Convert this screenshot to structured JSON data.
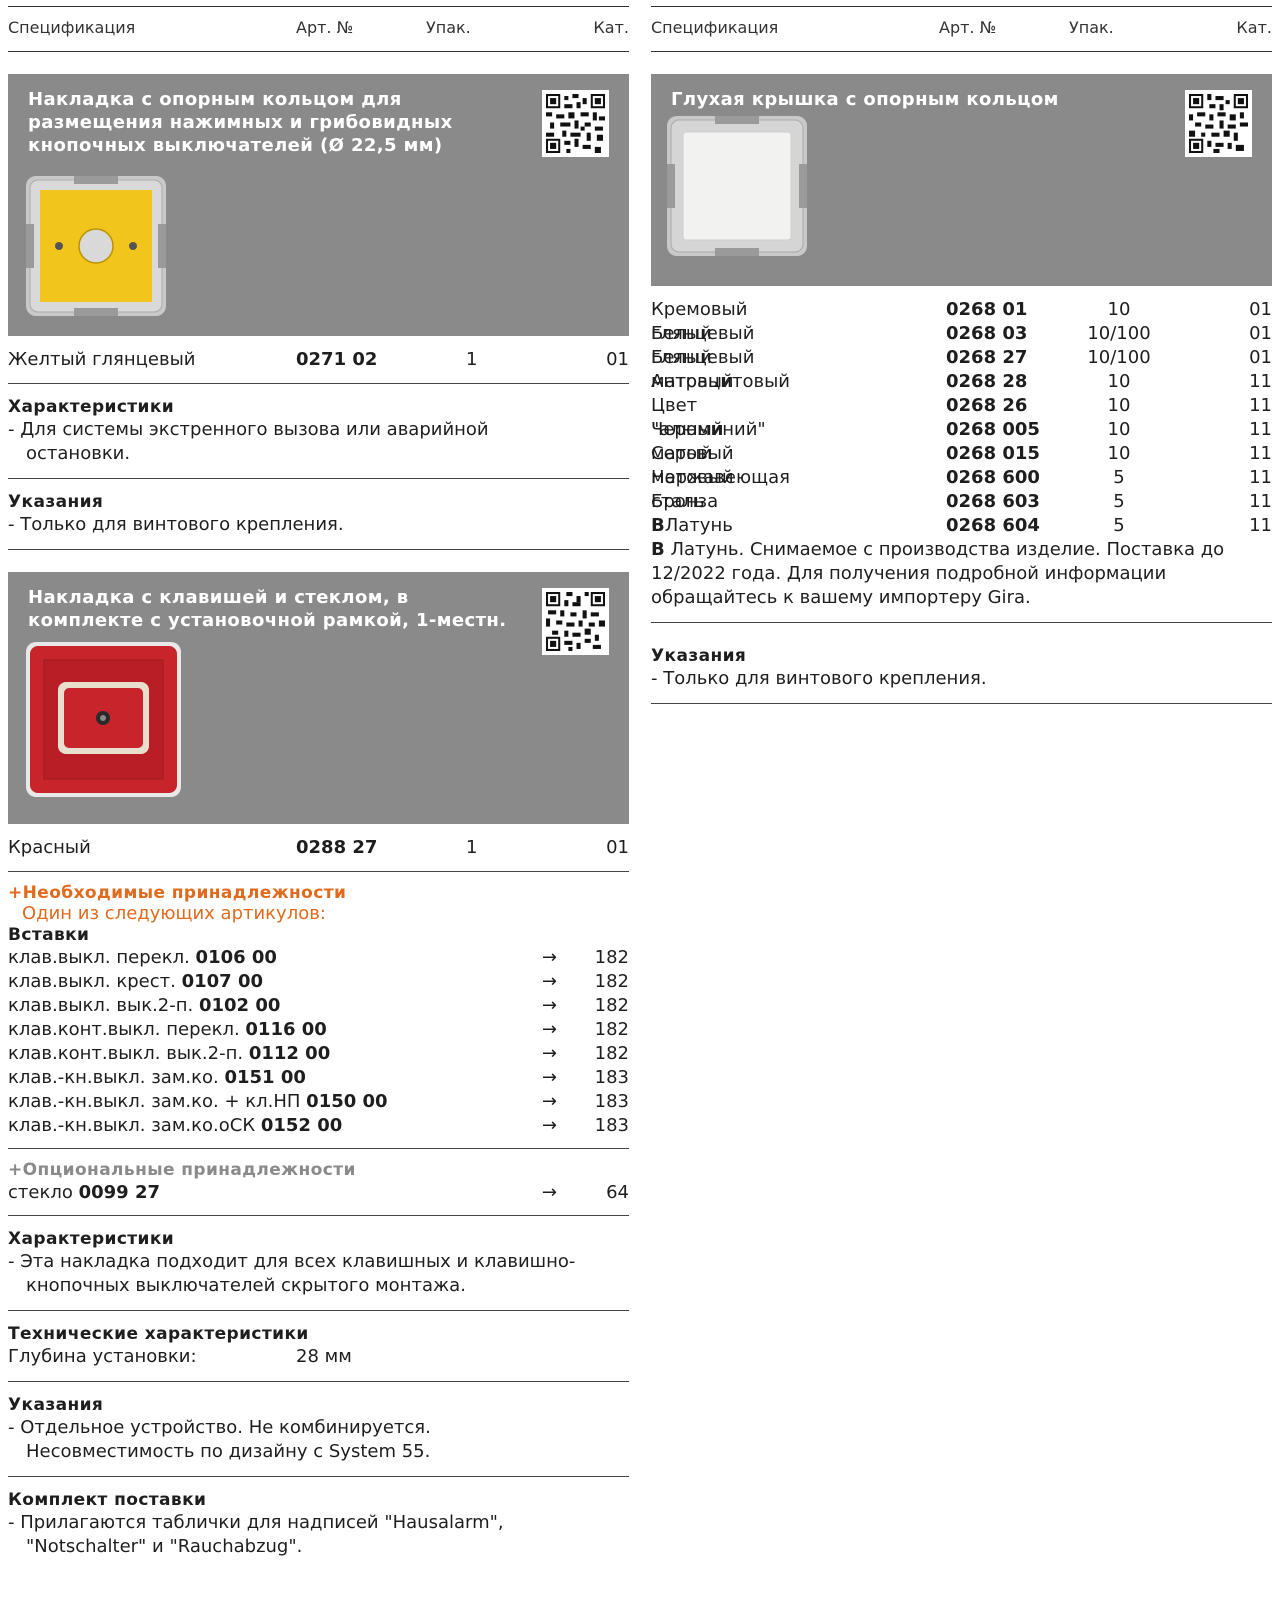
{
  "header": {
    "spec": "Спецификация",
    "art": "Арт. №",
    "pack": "Упак.",
    "cat": "Кат."
  },
  "left": {
    "product1": {
      "title_lines": [
        "Накладка с опорным кольцом для",
        "размещения нажимных и грибовидных",
        "кнопочных выключателей (Ø 22,5 мм)"
      ],
      "row": {
        "name": "Желтый глянцевый",
        "art": "0271 02",
        "pack": "1",
        "cat": "01"
      },
      "features_title": "Характеристики",
      "features": [
        "- Для системы экстренного вызова или аварийной остановки."
      ],
      "notes_title": "Указания",
      "notes": [
        "- Только для винтового крепления."
      ]
    },
    "product2": {
      "title_lines": [
        "Накладка с клавишей и стеклом, в",
        "комплекте с установочной рамкой, 1-местн."
      ],
      "row": {
        "name": "Красный",
        "art": "0288 27",
        "pack": "1",
        "cat": "01"
      },
      "required_title": "Необходимые принадлежности",
      "required_sub": "Один из следующих артикулов:",
      "inserts_title": "Вставки",
      "inserts": [
        {
          "text": "клав.выкл. перекл. ",
          "art": "0106 00",
          "page": "182"
        },
        {
          "text": "клав.выкл. крест. ",
          "art": "0107 00",
          "page": "182"
        },
        {
          "text": "клав.выкл. вык.2-п. ",
          "art": "0102 00",
          "page": "182"
        },
        {
          "text": "клав.конт.выкл. перекл. ",
          "art": "0116 00",
          "page": "182"
        },
        {
          "text": "клав.конт.выкл. вык.2-п. ",
          "art": "0112 00",
          "page": "182"
        },
        {
          "text": "клав.-кн.выкл. зам.ко. ",
          "art": "0151 00",
          "page": "183"
        },
        {
          "text": "клав.-кн.выкл. зам.ко. + кл.НП ",
          "art": "0150 00",
          "page": "183"
        },
        {
          "text": "клав.-кн.выкл. зам.ко.оСК ",
          "art": "0152 00",
          "page": "183"
        }
      ],
      "arrow": "→",
      "optional_title": "Опциональные принадлежности",
      "optional": [
        {
          "text": "стекло ",
          "art": "0099 27",
          "page": "64"
        }
      ],
      "features_title": "Характеристики",
      "features": [
        "- Эта накладка подходит для всех клавишных и клавишно-кнопочных выключателей скрытого монтажа."
      ],
      "tech_title": "Технические характеристики",
      "tech_label": "Глубина установки:",
      "tech_value": "28 мм",
      "notes_title": "Указания",
      "notes": [
        "- Отдельное устройство. Не комбинируется. Несовместимость по дизайну с System 55."
      ],
      "kit_title": "Комплект поставки",
      "kit": [
        "- Прилагаются таблички для надписей \"Hausalarm\", \"Notschalter\" и \"Rauchabzug\"."
      ]
    },
    "plus": "+"
  },
  "right": {
    "product": {
      "title": "Глухая крышка с опорным кольцом",
      "rows": [
        {
          "pre": "",
          "name": "Кремовый глянцевый",
          "art": "0268 01",
          "pack": "10",
          "cat": "01"
        },
        {
          "pre": "",
          "name": "Белый глянцевый",
          "art": "0268 03",
          "pack": "10/100",
          "cat": "01"
        },
        {
          "pre": "",
          "name": "Белый матовый",
          "art": "0268 27",
          "pack": "10/100",
          "cat": "01"
        },
        {
          "pre": "",
          "name": "Антрацитовый",
          "art": "0268 28",
          "pack": "10",
          "cat": "11"
        },
        {
          "pre": "",
          "name": "Цвет \"алюминий\"",
          "art": "0268 26",
          "pack": "10",
          "cat": "11"
        },
        {
          "pre": "",
          "name": "Черный матовый",
          "art": "0268 005",
          "pack": "10",
          "cat": "11"
        },
        {
          "pre": "",
          "name": "Серый матовый",
          "art": "0268 015",
          "pack": "10",
          "cat": "11"
        },
        {
          "pre": "",
          "name": "Нержавеющая сталь",
          "art": "0268 600",
          "pack": "5",
          "cat": "11"
        },
        {
          "pre": "",
          "name": "Бронза",
          "art": "0268 603",
          "pack": "5",
          "cat": "11"
        },
        {
          "pre": "B",
          "name": " Латунь",
          "art": "0268 604",
          "pack": "5",
          "cat": "11"
        }
      ],
      "footnote_marker": "B",
      "footnote": " Латунь. Снимаемое с производства изделие. Поставка до 12/2022 года. Для получения подробной информации обращайтесь к вашему импортеру Gira.",
      "notes_title": "Указания",
      "notes": [
        "- Только для винтового крепления."
      ]
    }
  },
  "colors": {
    "box": "#8a8a8a",
    "orange": "#e06a1e",
    "yellow": "#f2c51c",
    "red": "#c8242b"
  }
}
